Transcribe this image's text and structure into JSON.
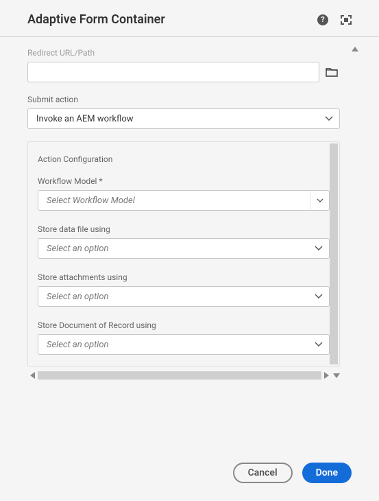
{
  "header": {
    "title": "Adaptive Form Container"
  },
  "fields": {
    "redirect": {
      "label": "Redirect URL/Path",
      "value": ""
    },
    "submit_action": {
      "label": "Submit action",
      "value": "Invoke an AEM workflow"
    }
  },
  "action_config": {
    "title": "Action Configuration",
    "workflow_model": {
      "label": "Workflow Model *",
      "placeholder": "Select Workflow Model"
    },
    "store_data": {
      "label": "Store data file using",
      "placeholder": "Select an option"
    },
    "store_attachments": {
      "label": "Store attachments using",
      "placeholder": "Select an option"
    },
    "store_dor": {
      "label": "Store Document of Record using",
      "placeholder": "Select an option"
    }
  },
  "footer": {
    "cancel": "Cancel",
    "done": "Done"
  }
}
